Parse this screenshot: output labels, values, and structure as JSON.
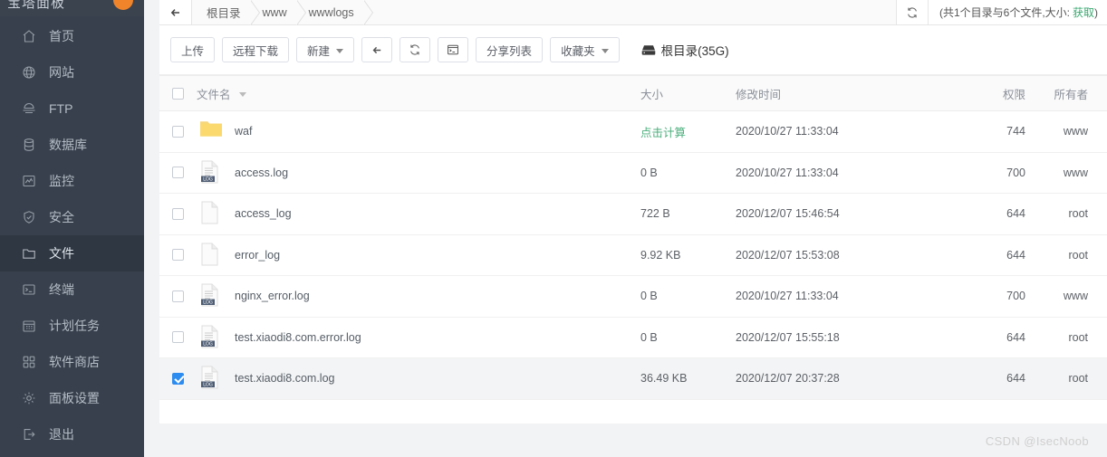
{
  "sidebar": {
    "logo_text": "宝塔面板",
    "badge": "orange-dot",
    "items": [
      {
        "icon": "home-icon",
        "label": "首页",
        "active": false
      },
      {
        "icon": "globe-icon",
        "label": "网站",
        "active": false
      },
      {
        "icon": "ftp-icon",
        "label": "FTP",
        "active": false
      },
      {
        "icon": "database-icon",
        "label": "数据库",
        "active": false
      },
      {
        "icon": "monitor-icon",
        "label": "监控",
        "active": false
      },
      {
        "icon": "shield-icon",
        "label": "安全",
        "active": false
      },
      {
        "icon": "folder-icon",
        "label": "文件",
        "active": true
      },
      {
        "icon": "terminal-icon",
        "label": "终端",
        "active": false
      },
      {
        "icon": "calendar-icon",
        "label": "计划任务",
        "active": false
      },
      {
        "icon": "grid-icon",
        "label": "软件商店",
        "active": false
      },
      {
        "icon": "gear-icon",
        "label": "面板设置",
        "active": false
      },
      {
        "icon": "logout-icon",
        "label": "退出",
        "active": false
      }
    ]
  },
  "breadcrumb": {
    "back_icon": "arrow-left-icon",
    "refresh_icon": "refresh-icon",
    "items": [
      "根目录",
      "www",
      "wwwlogs"
    ],
    "stat_prefix": "(共1个目录与6个文件,大小:",
    "stat_link": "获取",
    "stat_suffix": ")"
  },
  "toolbar": {
    "buttons": [
      {
        "label": "上传",
        "icon": "",
        "caret": false
      },
      {
        "label": "远程下载",
        "icon": "",
        "caret": false
      },
      {
        "label": "新建",
        "icon": "",
        "caret": true
      },
      {
        "label": "",
        "icon": "arrow-left-icon",
        "caret": false
      },
      {
        "label": "",
        "icon": "refresh-icon",
        "caret": false
      },
      {
        "label": "",
        "icon": "terminal-icon",
        "caret": false
      },
      {
        "label": "分享列表",
        "icon": "",
        "caret": false
      },
      {
        "label": "收藏夹",
        "icon": "",
        "caret": true
      }
    ],
    "disk_icon": "hdd-icon",
    "disk_label": "根目录(35G)"
  },
  "table": {
    "select_all_checked": false,
    "columns": {
      "name": "文件名",
      "size": "大小",
      "mtime": "修改时间",
      "perm": "权限",
      "owner": "所有者"
    },
    "sort_icon": "sort-desc-icon",
    "rows": [
      {
        "checked": false,
        "icon": "folder-icon",
        "name": "waf",
        "size": "点击计算",
        "size_is_link": true,
        "mtime": "2020/10/27 11:33:04",
        "perm": "744",
        "owner": "www"
      },
      {
        "checked": false,
        "icon": "log-file-icon",
        "name": "access.log",
        "size": "0 B",
        "size_is_link": false,
        "mtime": "2020/10/27 11:33:04",
        "perm": "700",
        "owner": "www"
      },
      {
        "checked": false,
        "icon": "file-icon",
        "name": "access_log",
        "size": "722 B",
        "size_is_link": false,
        "mtime": "2020/12/07 15:46:54",
        "perm": "644",
        "owner": "root"
      },
      {
        "checked": false,
        "icon": "file-icon",
        "name": "error_log",
        "size": "9.92 KB",
        "size_is_link": false,
        "mtime": "2020/12/07 15:53:08",
        "perm": "644",
        "owner": "root"
      },
      {
        "checked": false,
        "icon": "log-file-icon",
        "name": "nginx_error.log",
        "size": "0 B",
        "size_is_link": false,
        "mtime": "2020/10/27 11:33:04",
        "perm": "700",
        "owner": "www"
      },
      {
        "checked": false,
        "icon": "log-file-icon",
        "name": "test.xiaodi8.com.error.log",
        "size": "0 B",
        "size_is_link": false,
        "mtime": "2020/12/07 15:55:18",
        "perm": "644",
        "owner": "root"
      },
      {
        "checked": true,
        "icon": "log-file-icon",
        "name": "test.xiaodi8.com.log",
        "size": "36.49 KB",
        "size_is_link": false,
        "mtime": "2020/12/07 20:37:28",
        "perm": "644",
        "owner": "root"
      }
    ]
  },
  "watermark": "CSDN @IsecNoob",
  "colors": {
    "sidebar_bg": "#37404c",
    "sidebar_active": "#2f3742",
    "accent_orange": "#f0842a",
    "link_green": "#4caf7d",
    "checkbox_blue": "#2d8cf0"
  }
}
